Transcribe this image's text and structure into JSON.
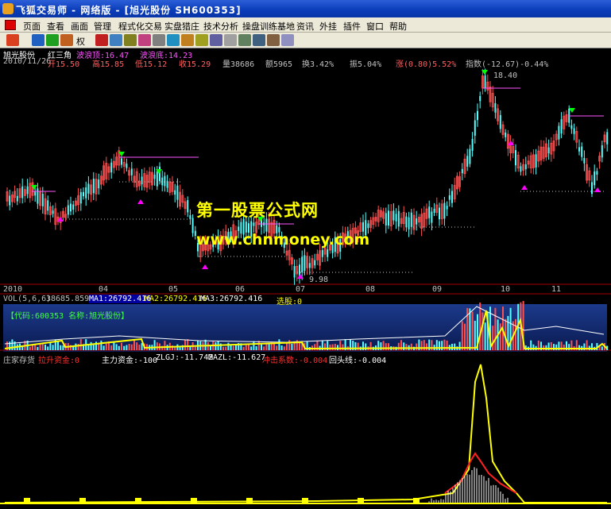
{
  "window": {
    "title": "飞狐交易师 - 网络版 - [旭光股份 SH600353]"
  },
  "menu": [
    "页面",
    "查看",
    "画面",
    "管理",
    "程式化交易",
    "实盘猎庄",
    "技术分析",
    "操盘训练基地",
    "资讯",
    "外挂",
    "插件",
    "窗口",
    "帮助"
  ],
  "toolbar": {
    "selected": "权"
  },
  "price_panel": {
    "stock_label": "旭光股份",
    "indicator_name": "红三角",
    "wave_top_label": "波浪顶:16.47",
    "wave_bottom_label": "波浪底:14.23",
    "info_line": {
      "date": "2010/11/26",
      "open": "开15.50",
      "high": "高15.85",
      "low": "低15.12",
      "close": "收15.29",
      "volume": "量38686",
      "amount": "额5965",
      "turnover": "换3.42%",
      "amplitude": "振5.04%",
      "change": "涨(0.80)5.52%",
      "index": "指数(-12.67)-0.44%"
    },
    "high_marker": "18.40",
    "low_marker": "9.98"
  },
  "watermark": {
    "line1": "第一股票公式网",
    "line2": "www.chnmoney.com"
  },
  "date_axis": [
    "2010",
    "04",
    "05",
    "06",
    "07",
    "08",
    "09",
    "10",
    "11"
  ],
  "vol_panel": {
    "title": "VOL(5,6,6)",
    "value": "38685.859",
    "ma1": "MA1:26792.416",
    "ma2": "MA2:26792.416",
    "ma3": "MA3:26792.416",
    "extra": "选股:0",
    "code_box": "【代码:600353 名称:旭光股份】"
  },
  "lower_panel": {
    "title": "庄家存货",
    "labels": [
      "拉升资金:0",
      "主力资金:-100",
      "ZLGJ:-11.742",
      "MAZL:-11.627",
      "冲击系数:-0.004",
      "回头线:-0.004"
    ]
  },
  "colors": {
    "up": "#ff5050",
    "down": "#54ffff",
    "ma": "#ffffff",
    "accent": "#ffff00",
    "signal_up": "#ff00ff",
    "signal_down": "#00ff00"
  }
}
